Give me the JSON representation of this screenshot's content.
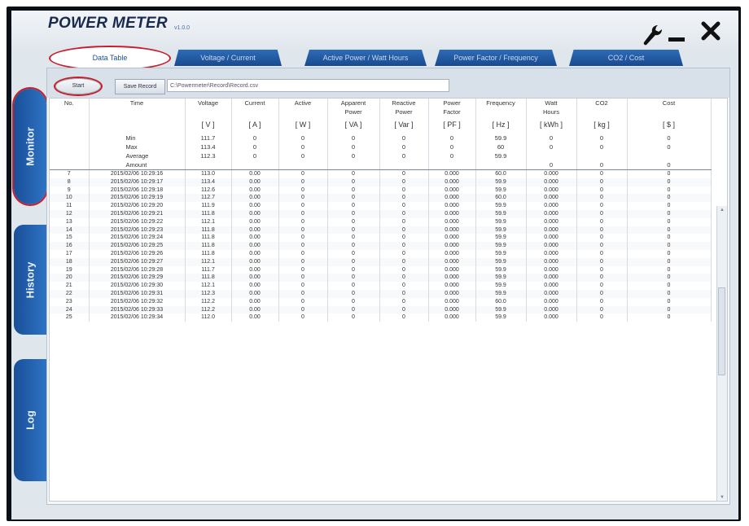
{
  "app": {
    "title": "POWER METER",
    "version": "v1.0.0",
    "accent": "#1a4f98"
  },
  "toolbar_icons": [
    "wrench-icon",
    "minimize-icon",
    "close-icon"
  ],
  "tabs": [
    "Data Table",
    "Voltage / Current",
    "Active Power / Watt Hours",
    "Power Factor / Frequency",
    "CO2 / Cost"
  ],
  "side_tabs": [
    "Monitor",
    "History",
    "Log"
  ],
  "controls": {
    "start_label": "Start",
    "save_label": "Save Record",
    "file_path": "C:\\Powermeter\\Record\\Record.csv"
  },
  "columns": [
    {
      "name": "No.",
      "name2": "",
      "unit": ""
    },
    {
      "name": "Time",
      "name2": "",
      "unit": ""
    },
    {
      "name": "Voltage",
      "name2": "",
      "unit": "[ V ]"
    },
    {
      "name": "Current",
      "name2": "",
      "unit": "[ A ]"
    },
    {
      "name": "Active",
      "name2": "",
      "unit": "[ W ]"
    },
    {
      "name": "Apparent",
      "name2": "Power",
      "unit": "[ VA ]"
    },
    {
      "name": "Reactive",
      "name2": "Power",
      "unit": "[ Var ]"
    },
    {
      "name": "Power",
      "name2": "Factor",
      "unit": "[ PF ]"
    },
    {
      "name": "Frequency",
      "name2": "",
      "unit": "[ Hz ]"
    },
    {
      "name": "Watt",
      "name2": "Hours",
      "unit": "[ kWh ]"
    },
    {
      "name": "CO2",
      "name2": "",
      "unit": "[ kg ]"
    },
    {
      "name": "Cost",
      "name2": "",
      "unit": "[ $ ]"
    }
  ],
  "stats": [
    {
      "label": "Min",
      "values": [
        "",
        "",
        "111.7",
        "0",
        "0",
        "0",
        "0",
        "0",
        "59.9",
        "0",
        "0",
        "0"
      ]
    },
    {
      "label": "Max",
      "values": [
        "",
        "",
        "113.4",
        "0",
        "0",
        "0",
        "0",
        "0",
        "60",
        "0",
        "0",
        "0"
      ]
    },
    {
      "label": "Average",
      "values": [
        "",
        "",
        "112.3",
        "0",
        "0",
        "0",
        "0",
        "0",
        "59.9",
        "",
        "",
        ""
      ]
    },
    {
      "label": "Amount",
      "values": [
        "",
        "",
        "",
        "",
        "",
        "",
        "",
        "",
        "",
        "0",
        "0",
        "0"
      ]
    }
  ],
  "rows": [
    [
      "7",
      "2015/02/06 10:29:16",
      "113.0",
      "0.00",
      "0",
      "0",
      "0",
      "0.000",
      "60.0",
      "0.000",
      "0",
      "0"
    ],
    [
      "8",
      "2015/02/06 10:29:17",
      "113.4",
      "0.00",
      "0",
      "0",
      "0",
      "0.000",
      "59.9",
      "0.000",
      "0",
      "0"
    ],
    [
      "9",
      "2015/02/06 10:29:18",
      "112.6",
      "0.00",
      "0",
      "0",
      "0",
      "0.000",
      "59.9",
      "0.000",
      "0",
      "0"
    ],
    [
      "10",
      "2015/02/06 10:29:19",
      "112.7",
      "0.00",
      "0",
      "0",
      "0",
      "0.000",
      "60.0",
      "0.000",
      "0",
      "0"
    ],
    [
      "11",
      "2015/02/06 10:29:20",
      "111.9",
      "0.00",
      "0",
      "0",
      "0",
      "0.000",
      "59.9",
      "0.000",
      "0",
      "0"
    ],
    [
      "12",
      "2015/02/06 10:29:21",
      "111.8",
      "0.00",
      "0",
      "0",
      "0",
      "0.000",
      "59.9",
      "0.000",
      "0",
      "0"
    ],
    [
      "13",
      "2015/02/06 10:29:22",
      "112.1",
      "0.00",
      "0",
      "0",
      "0",
      "0.000",
      "59.9",
      "0.000",
      "0",
      "0"
    ],
    [
      "14",
      "2015/02/06 10:29:23",
      "111.8",
      "0.00",
      "0",
      "0",
      "0",
      "0.000",
      "59.9",
      "0.000",
      "0",
      "0"
    ],
    [
      "15",
      "2015/02/06 10:29:24",
      "111.8",
      "0.00",
      "0",
      "0",
      "0",
      "0.000",
      "59.9",
      "0.000",
      "0",
      "0"
    ],
    [
      "16",
      "2015/02/06 10:29:25",
      "111.8",
      "0.00",
      "0",
      "0",
      "0",
      "0.000",
      "59.9",
      "0.000",
      "0",
      "0"
    ],
    [
      "17",
      "2015/02/06 10:29:26",
      "111.8",
      "0.00",
      "0",
      "0",
      "0",
      "0.000",
      "59.9",
      "0.000",
      "0",
      "0"
    ],
    [
      "18",
      "2015/02/06 10:29:27",
      "112.1",
      "0.00",
      "0",
      "0",
      "0",
      "0.000",
      "59.9",
      "0.000",
      "0",
      "0"
    ],
    [
      "19",
      "2015/02/06 10:29:28",
      "111.7",
      "0.00",
      "0",
      "0",
      "0",
      "0.000",
      "59.9",
      "0.000",
      "0",
      "0"
    ],
    [
      "20",
      "2015/02/06 10:29:29",
      "111.8",
      "0.00",
      "0",
      "0",
      "0",
      "0.000",
      "59.9",
      "0.000",
      "0",
      "0"
    ],
    [
      "21",
      "2015/02/06 10:29:30",
      "112.1",
      "0.00",
      "0",
      "0",
      "0",
      "0.000",
      "59.9",
      "0.000",
      "0",
      "0"
    ],
    [
      "22",
      "2015/02/06 10:29:31",
      "112.3",
      "0.00",
      "0",
      "0",
      "0",
      "0.000",
      "59.9",
      "0.000",
      "0",
      "0"
    ],
    [
      "23",
      "2015/02/06 10:29:32",
      "112.2",
      "0.00",
      "0",
      "0",
      "0",
      "0.000",
      "60.0",
      "0.000",
      "0",
      "0"
    ],
    [
      "24",
      "2015/02/06 10:29:33",
      "112.2",
      "0.00",
      "0",
      "0",
      "0",
      "0.000",
      "59.9",
      "0.000",
      "0",
      "0"
    ],
    [
      "25",
      "2015/02/06 10:29:34",
      "112.0",
      "0.00",
      "0",
      "0",
      "0",
      "0.000",
      "59.9",
      "0.000",
      "0",
      "0"
    ]
  ]
}
